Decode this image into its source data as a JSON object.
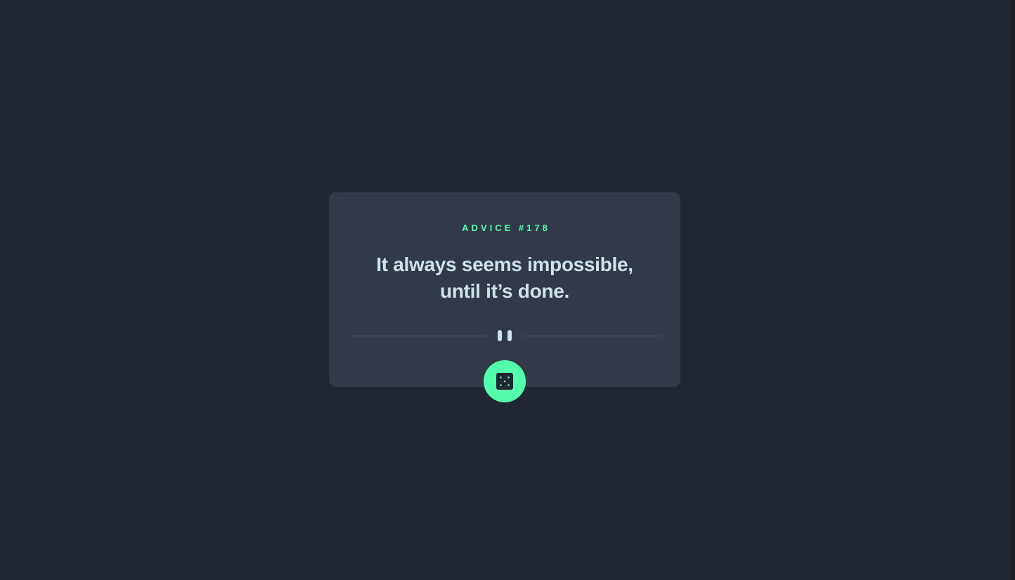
{
  "advice": {
    "id_label": "ADVICE #178",
    "quote": "It always seems impossible, until it’s done."
  },
  "icons": {
    "divider": "pause-icon",
    "button": "dice-icon"
  },
  "colors": {
    "background": "#202632",
    "card": "#323a49",
    "accent": "#53ffaa",
    "quote_text": "#cee3e9",
    "divider_line": "#4f5d74"
  }
}
